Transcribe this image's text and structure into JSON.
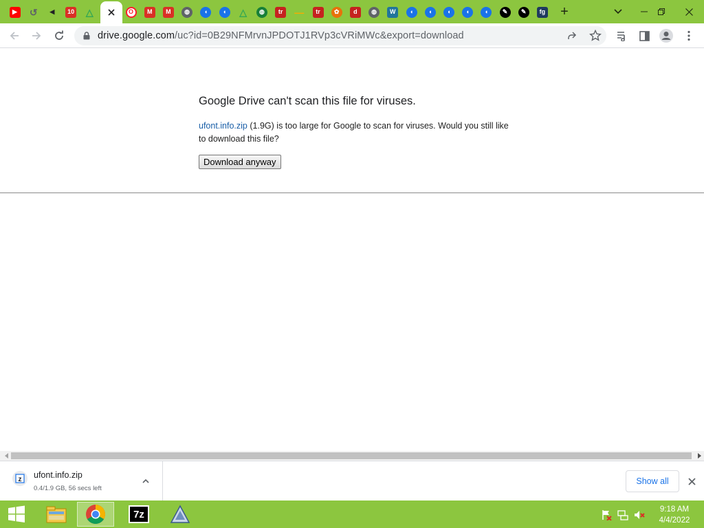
{
  "browser": {
    "url_domain": "drive.google.com",
    "url_path": "/uc?id=0B29NFMrvnJPDOTJ1RVp3cVRiMWc&export=download",
    "tabs": [
      {
        "icon": "youtube-icon",
        "color": "#ff0000",
        "text": "▶"
      },
      {
        "icon": "history-icon",
        "color": "#5f6368",
        "text": "↺"
      },
      {
        "icon": "speaker-icon",
        "color": "#202124",
        "text": "◀"
      },
      {
        "icon": "badge-icon",
        "color": "#d93025",
        "text": "10"
      },
      {
        "icon": "google-drive-icon",
        "color": "#34a853",
        "text": "△"
      },
      {
        "icon": "opera-icon",
        "color": "#ff1b2d",
        "text": "O"
      },
      {
        "icon": "gmail-icon",
        "color": "#d93025",
        "text": "M"
      },
      {
        "icon": "gmail-icon",
        "color": "#d93025",
        "text": "M"
      },
      {
        "icon": "globe-icon",
        "color": "#5f6368",
        "text": "◍"
      },
      {
        "icon": "wave-icon",
        "color": "#1a73e8",
        "text": "◖"
      },
      {
        "icon": "wave-icon",
        "color": "#1a73e8",
        "text": "◖"
      },
      {
        "icon": "google-drive-icon",
        "color": "#34a853",
        "text": "△"
      },
      {
        "icon": "globe-icon",
        "color": "#188038",
        "text": "◍"
      },
      {
        "icon": "tr-icon",
        "color": "#c5221f",
        "text": "tr"
      },
      {
        "icon": "bar-icon",
        "color": "#f9ab00",
        "text": "—"
      },
      {
        "icon": "tr-icon",
        "color": "#c5221f",
        "text": "tr"
      },
      {
        "icon": "flower-icon",
        "color": "#e8710a",
        "text": "✿"
      },
      {
        "icon": "d-icon",
        "color": "#c5221f",
        "text": "d"
      },
      {
        "icon": "globe-icon",
        "color": "#5f6368",
        "text": "◍"
      },
      {
        "icon": "wordpress-icon",
        "color": "#21759b",
        "text": "W"
      },
      {
        "icon": "wave-icon",
        "color": "#1a73e8",
        "text": "◖"
      },
      {
        "icon": "wave-icon",
        "color": "#1a73e8",
        "text": "◖"
      },
      {
        "icon": "wave-icon",
        "color": "#1a73e8",
        "text": "◖"
      },
      {
        "icon": "wave-icon",
        "color": "#1a73e8",
        "text": "◖"
      },
      {
        "icon": "wave-icon",
        "color": "#1a73e8",
        "text": "◖"
      },
      {
        "icon": "feather-icon",
        "color": "#000000",
        "text": "✎"
      },
      {
        "icon": "feather-icon",
        "color": "#000000",
        "text": "✎"
      },
      {
        "icon": "fg-icon",
        "color": "#1f3a5f",
        "text": "fg"
      }
    ],
    "active_tab_icon": "close-icon",
    "new_tab_label": "+"
  },
  "page": {
    "title": "Google Drive can't scan this file for viruses.",
    "file_link": "ufont.info.zip",
    "file_size": "(1.9G)",
    "message": "is too large for Google to scan for viruses. Would you still like to download this file?",
    "button_label": "Download anyway"
  },
  "download": {
    "filename": "ufont.info.zip",
    "status": "0.4/1.9 GB, 56 secs left",
    "show_all_label": "Show all"
  },
  "taskbar": {
    "time": "9:18 AM",
    "date": "4/4/2022",
    "apps": [
      "file-explorer-icon",
      "chrome-icon",
      "7zip-icon",
      "triangle-app-icon"
    ],
    "seven_zip_label": "7z"
  },
  "colors": {
    "accent": "#8cc63f",
    "link": "#1a5fa8",
    "show_all": "#1a73e8"
  }
}
